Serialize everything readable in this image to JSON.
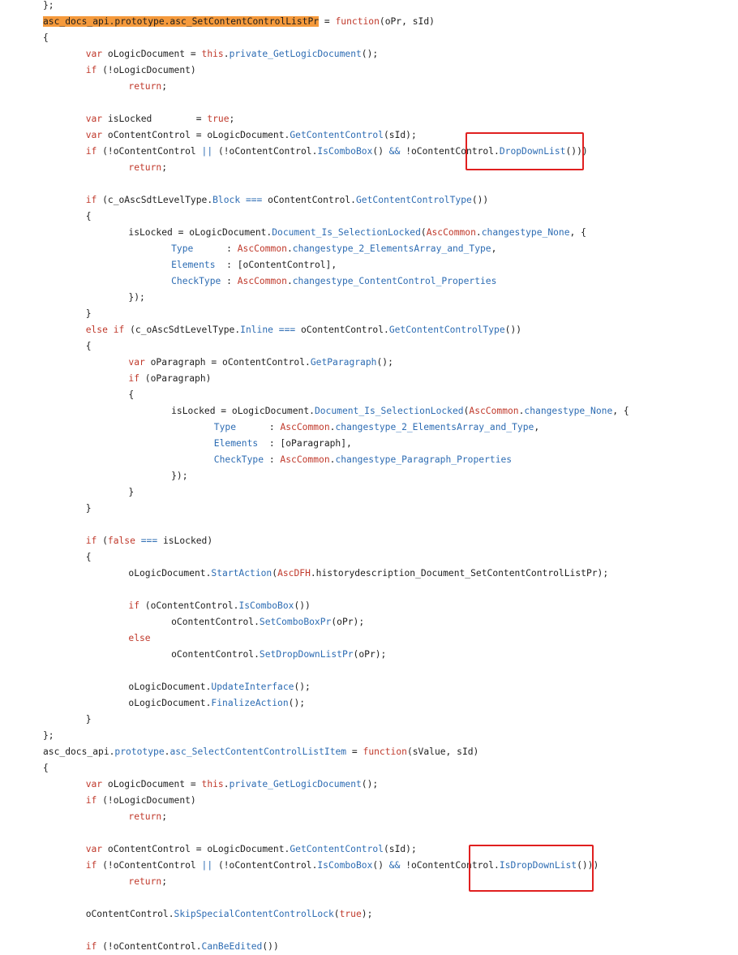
{
  "code_lines": [
    {
      "indent": 0,
      "tokens": [
        {
          "t": "};",
          "c": ""
        }
      ]
    },
    {
      "indent": 0,
      "tokens": [
        {
          "t": "asc_docs_api.prototype.asc_SetContentControlListPr",
          "c": "hl"
        },
        {
          "t": " = ",
          "c": ""
        },
        {
          "t": "function",
          "c": "kw"
        },
        {
          "t": "(oPr, sId)",
          "c": ""
        }
      ]
    },
    {
      "indent": 0,
      "tokens": [
        {
          "t": "{",
          "c": ""
        }
      ]
    },
    {
      "indent": 1,
      "tokens": [
        {
          "t": "var",
          "c": "kw"
        },
        {
          "t": " oLogicDocument = ",
          "c": ""
        },
        {
          "t": "this",
          "c": "kw"
        },
        {
          "t": ".",
          "c": ""
        },
        {
          "t": "private_GetLogicDocument",
          "c": "fn"
        },
        {
          "t": "();",
          "c": ""
        }
      ]
    },
    {
      "indent": 1,
      "tokens": [
        {
          "t": "if",
          "c": "kw"
        },
        {
          "t": " (!oLogicDocument)",
          "c": ""
        }
      ]
    },
    {
      "indent": 2,
      "tokens": [
        {
          "t": "return",
          "c": "kw"
        },
        {
          "t": ";",
          "c": ""
        }
      ]
    },
    {
      "indent": 0,
      "tokens": []
    },
    {
      "indent": 1,
      "tokens": [
        {
          "t": "var",
          "c": "kw"
        },
        {
          "t": " isLocked        = ",
          "c": ""
        },
        {
          "t": "true",
          "c": "kw"
        },
        {
          "t": ";",
          "c": ""
        }
      ]
    },
    {
      "indent": 1,
      "tokens": [
        {
          "t": "var",
          "c": "kw"
        },
        {
          "t": " oContentControl = oLogicDocument.",
          "c": ""
        },
        {
          "t": "GetContentControl",
          "c": "fn"
        },
        {
          "t": "(sId);",
          "c": ""
        }
      ]
    },
    {
      "indent": 1,
      "tokens": [
        {
          "t": "if",
          "c": "kw"
        },
        {
          "t": " (!oContentControl ",
          "c": ""
        },
        {
          "t": "||",
          "c": "fn"
        },
        {
          "t": " (!oContentControl.",
          "c": ""
        },
        {
          "t": "IsComboBox",
          "c": "fn"
        },
        {
          "t": "() ",
          "c": ""
        },
        {
          "t": "&&",
          "c": "fn"
        },
        {
          "t": " !oContentControl.",
          "c": ""
        },
        {
          "t": "DropDownList",
          "c": "fn"
        },
        {
          "t": "()))",
          "c": ""
        }
      ]
    },
    {
      "indent": 2,
      "tokens": [
        {
          "t": "return",
          "c": "kw"
        },
        {
          "t": ";",
          "c": ""
        }
      ]
    },
    {
      "indent": 0,
      "tokens": []
    },
    {
      "indent": 1,
      "tokens": [
        {
          "t": "if",
          "c": "kw"
        },
        {
          "t": " (c_oAscSdtLevelType.",
          "c": ""
        },
        {
          "t": "Block",
          "c": "prop"
        },
        {
          "t": " ",
          "c": ""
        },
        {
          "t": "===",
          "c": "fn"
        },
        {
          "t": " oContentControl.",
          "c": ""
        },
        {
          "t": "GetContentControlType",
          "c": "fn"
        },
        {
          "t": "())",
          "c": ""
        }
      ]
    },
    {
      "indent": 1,
      "tokens": [
        {
          "t": "{",
          "c": ""
        }
      ]
    },
    {
      "indent": 2,
      "tokens": [
        {
          "t": "isLocked = oLogicDocument.",
          "c": ""
        },
        {
          "t": "Document_Is_SelectionLocked",
          "c": "fn"
        },
        {
          "t": "(",
          "c": ""
        },
        {
          "t": "AscCommon",
          "c": "kw"
        },
        {
          "t": ".",
          "c": ""
        },
        {
          "t": "changestype_None",
          "c": "prop"
        },
        {
          "t": ", {",
          "c": ""
        }
      ]
    },
    {
      "indent": 3,
      "tokens": [
        {
          "t": "Type",
          "c": "prop"
        },
        {
          "t": "      : ",
          "c": ""
        },
        {
          "t": "AscCommon",
          "c": "kw"
        },
        {
          "t": ".",
          "c": ""
        },
        {
          "t": "changestype_2_ElementsArray_and_Type",
          "c": "prop"
        },
        {
          "t": ",",
          "c": ""
        }
      ]
    },
    {
      "indent": 3,
      "tokens": [
        {
          "t": "Elements",
          "c": "prop"
        },
        {
          "t": "  : [oContentControl],",
          "c": ""
        }
      ]
    },
    {
      "indent": 3,
      "tokens": [
        {
          "t": "CheckType",
          "c": "prop"
        },
        {
          "t": " : ",
          "c": ""
        },
        {
          "t": "AscCommon",
          "c": "kw"
        },
        {
          "t": ".",
          "c": ""
        },
        {
          "t": "changestype_ContentControl_Properties",
          "c": "prop"
        }
      ]
    },
    {
      "indent": 2,
      "tokens": [
        {
          "t": "});",
          "c": ""
        }
      ]
    },
    {
      "indent": 1,
      "tokens": [
        {
          "t": "}",
          "c": ""
        }
      ]
    },
    {
      "indent": 1,
      "tokens": [
        {
          "t": "else",
          "c": "kw"
        },
        {
          "t": " ",
          "c": ""
        },
        {
          "t": "if",
          "c": "kw"
        },
        {
          "t": " (c_oAscSdtLevelType.",
          "c": ""
        },
        {
          "t": "Inline",
          "c": "prop"
        },
        {
          "t": " ",
          "c": ""
        },
        {
          "t": "===",
          "c": "fn"
        },
        {
          "t": " oContentControl.",
          "c": ""
        },
        {
          "t": "GetContentControlType",
          "c": "fn"
        },
        {
          "t": "())",
          "c": ""
        }
      ]
    },
    {
      "indent": 1,
      "tokens": [
        {
          "t": "{",
          "c": ""
        }
      ]
    },
    {
      "indent": 2,
      "tokens": [
        {
          "t": "var",
          "c": "kw"
        },
        {
          "t": " oParagraph = oContentControl.",
          "c": ""
        },
        {
          "t": "GetParagraph",
          "c": "fn"
        },
        {
          "t": "();",
          "c": ""
        }
      ]
    },
    {
      "indent": 2,
      "tokens": [
        {
          "t": "if",
          "c": "kw"
        },
        {
          "t": " (oParagraph)",
          "c": ""
        }
      ]
    },
    {
      "indent": 2,
      "tokens": [
        {
          "t": "{",
          "c": ""
        }
      ]
    },
    {
      "indent": 3,
      "tokens": [
        {
          "t": "isLocked = oLogicDocument.",
          "c": ""
        },
        {
          "t": "Document_Is_SelectionLocked",
          "c": "fn"
        },
        {
          "t": "(",
          "c": ""
        },
        {
          "t": "AscCommon",
          "c": "kw"
        },
        {
          "t": ".",
          "c": ""
        },
        {
          "t": "changestype_None",
          "c": "prop"
        },
        {
          "t": ", {",
          "c": ""
        }
      ]
    },
    {
      "indent": 4,
      "tokens": [
        {
          "t": "Type",
          "c": "prop"
        },
        {
          "t": "      : ",
          "c": ""
        },
        {
          "t": "AscCommon",
          "c": "kw"
        },
        {
          "t": ".",
          "c": ""
        },
        {
          "t": "changestype_2_ElementsArray_and_Type",
          "c": "prop"
        },
        {
          "t": ",",
          "c": ""
        }
      ]
    },
    {
      "indent": 4,
      "tokens": [
        {
          "t": "Elements",
          "c": "prop"
        },
        {
          "t": "  : [oParagraph],",
          "c": ""
        }
      ]
    },
    {
      "indent": 4,
      "tokens": [
        {
          "t": "CheckType",
          "c": "prop"
        },
        {
          "t": " : ",
          "c": ""
        },
        {
          "t": "AscCommon",
          "c": "kw"
        },
        {
          "t": ".",
          "c": ""
        },
        {
          "t": "changestype_Paragraph_Properties",
          "c": "prop"
        }
      ]
    },
    {
      "indent": 3,
      "tokens": [
        {
          "t": "});",
          "c": ""
        }
      ]
    },
    {
      "indent": 2,
      "tokens": [
        {
          "t": "}",
          "c": ""
        }
      ]
    },
    {
      "indent": 1,
      "tokens": [
        {
          "t": "}",
          "c": ""
        }
      ]
    },
    {
      "indent": 0,
      "tokens": []
    },
    {
      "indent": 1,
      "tokens": [
        {
          "t": "if",
          "c": "kw"
        },
        {
          "t": " (",
          "c": ""
        },
        {
          "t": "false",
          "c": "kw"
        },
        {
          "t": " ",
          "c": ""
        },
        {
          "t": "===",
          "c": "fn"
        },
        {
          "t": " isLocked)",
          "c": ""
        }
      ]
    },
    {
      "indent": 1,
      "tokens": [
        {
          "t": "{",
          "c": ""
        }
      ]
    },
    {
      "indent": 2,
      "tokens": [
        {
          "t": "oLogicDocument.",
          "c": ""
        },
        {
          "t": "StartAction",
          "c": "fn"
        },
        {
          "t": "(",
          "c": ""
        },
        {
          "t": "AscDFH",
          "c": "kw"
        },
        {
          "t": ".historydescription_Document_SetContentControlListPr);",
          "c": ""
        }
      ]
    },
    {
      "indent": 0,
      "tokens": []
    },
    {
      "indent": 2,
      "tokens": [
        {
          "t": "if",
          "c": "kw"
        },
        {
          "t": " (oContentControl.",
          "c": ""
        },
        {
          "t": "IsComboBox",
          "c": "fn"
        },
        {
          "t": "())",
          "c": ""
        }
      ]
    },
    {
      "indent": 3,
      "tokens": [
        {
          "t": "oContentControl.",
          "c": ""
        },
        {
          "t": "SetComboBoxPr",
          "c": "fn"
        },
        {
          "t": "(oPr);",
          "c": ""
        }
      ]
    },
    {
      "indent": 2,
      "tokens": [
        {
          "t": "else",
          "c": "kw"
        }
      ]
    },
    {
      "indent": 3,
      "tokens": [
        {
          "t": "oContentControl.",
          "c": ""
        },
        {
          "t": "SetDropDownListPr",
          "c": "fn"
        },
        {
          "t": "(oPr);",
          "c": ""
        }
      ]
    },
    {
      "indent": 0,
      "tokens": []
    },
    {
      "indent": 2,
      "tokens": [
        {
          "t": "oLogicDocument.",
          "c": ""
        },
        {
          "t": "UpdateInterface",
          "c": "fn"
        },
        {
          "t": "();",
          "c": ""
        }
      ]
    },
    {
      "indent": 2,
      "tokens": [
        {
          "t": "oLogicDocument.",
          "c": ""
        },
        {
          "t": "FinalizeAction",
          "c": "fn"
        },
        {
          "t": "();",
          "c": ""
        }
      ]
    },
    {
      "indent": 1,
      "tokens": [
        {
          "t": "}",
          "c": ""
        }
      ]
    },
    {
      "indent": 0,
      "tokens": [
        {
          "t": "};",
          "c": ""
        }
      ]
    },
    {
      "indent": 0,
      "tokens": [
        {
          "t": "asc_docs_api.",
          "c": ""
        },
        {
          "t": "prototype",
          "c": "prop"
        },
        {
          "t": ".",
          "c": ""
        },
        {
          "t": "asc_SelectContentControlListItem",
          "c": "fn"
        },
        {
          "t": " = ",
          "c": ""
        },
        {
          "t": "function",
          "c": "kw"
        },
        {
          "t": "(sValue, sId)",
          "c": ""
        }
      ]
    },
    {
      "indent": 0,
      "tokens": [
        {
          "t": "{",
          "c": ""
        }
      ]
    },
    {
      "indent": 1,
      "tokens": [
        {
          "t": "var",
          "c": "kw"
        },
        {
          "t": " oLogicDocument = ",
          "c": ""
        },
        {
          "t": "this",
          "c": "kw"
        },
        {
          "t": ".",
          "c": ""
        },
        {
          "t": "private_GetLogicDocument",
          "c": "fn"
        },
        {
          "t": "();",
          "c": ""
        }
      ]
    },
    {
      "indent": 1,
      "tokens": [
        {
          "t": "if",
          "c": "kw"
        },
        {
          "t": " (!oLogicDocument)",
          "c": ""
        }
      ]
    },
    {
      "indent": 2,
      "tokens": [
        {
          "t": "return",
          "c": "kw"
        },
        {
          "t": ";",
          "c": ""
        }
      ]
    },
    {
      "indent": 0,
      "tokens": []
    },
    {
      "indent": 1,
      "tokens": [
        {
          "t": "var",
          "c": "kw"
        },
        {
          "t": " oContentControl = oLogicDocument.",
          "c": ""
        },
        {
          "t": "GetContentControl",
          "c": "fn"
        },
        {
          "t": "(sId);",
          "c": ""
        }
      ]
    },
    {
      "indent": 1,
      "tokens": [
        {
          "t": "if",
          "c": "kw"
        },
        {
          "t": " (!oContentControl ",
          "c": ""
        },
        {
          "t": "||",
          "c": "fn"
        },
        {
          "t": " (!oContentControl.",
          "c": ""
        },
        {
          "t": "IsComboBox",
          "c": "fn"
        },
        {
          "t": "() ",
          "c": ""
        },
        {
          "t": "&&",
          "c": "fn"
        },
        {
          "t": " !oContentControl.",
          "c": ""
        },
        {
          "t": "IsDropDownList",
          "c": "fn"
        },
        {
          "t": "()))",
          "c": ""
        }
      ]
    },
    {
      "indent": 2,
      "tokens": [
        {
          "t": "return",
          "c": "kw"
        },
        {
          "t": ";",
          "c": ""
        }
      ]
    },
    {
      "indent": 0,
      "tokens": []
    },
    {
      "indent": 1,
      "tokens": [
        {
          "t": "oContentControl.",
          "c": ""
        },
        {
          "t": "SkipSpecialContentControlLock",
          "c": "fn"
        },
        {
          "t": "(",
          "c": ""
        },
        {
          "t": "true",
          "c": "kw"
        },
        {
          "t": ");",
          "c": ""
        }
      ]
    },
    {
      "indent": 0,
      "tokens": []
    },
    {
      "indent": 1,
      "tokens": [
        {
          "t": "if",
          "c": "kw"
        },
        {
          "t": " (!oContentControl.",
          "c": ""
        },
        {
          "t": "CanBeEdited",
          "c": "fn"
        },
        {
          "t": "())",
          "c": ""
        }
      ]
    }
  ],
  "colors": {
    "keyword": "#c0392b",
    "identifier": "#2d6cb3",
    "highlight": "#f59a3c",
    "annotation_box": "#e02020"
  }
}
